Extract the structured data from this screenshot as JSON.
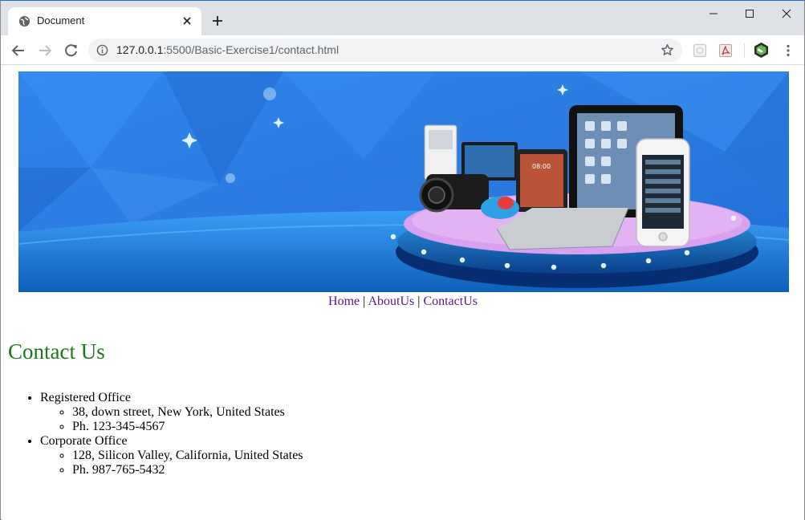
{
  "browser": {
    "tab_title": "Document",
    "url_host": "127.0.0.1",
    "url_port": ":5500",
    "url_path": "/Basic-Exercise1/contact.html"
  },
  "nav": {
    "home": "Home",
    "about": "AboutUs",
    "contact": "ContactUs",
    "separator": "|"
  },
  "page": {
    "heading": "Contact Us",
    "offices": [
      {
        "name": "Registered Office",
        "address": "38, down street, New York, United States",
        "phone": "Ph. 123-345-4567"
      },
      {
        "name": "Corporate Office",
        "address": "128, Silicon Valley, California, United States",
        "phone": "Ph. 987-765-5432"
      }
    ]
  },
  "banner": {
    "device_screen_text": "08:00"
  },
  "colors": {
    "heading": "#1a7a1a",
    "link": "#551a8b",
    "banner_blue": "#2a7de1"
  }
}
